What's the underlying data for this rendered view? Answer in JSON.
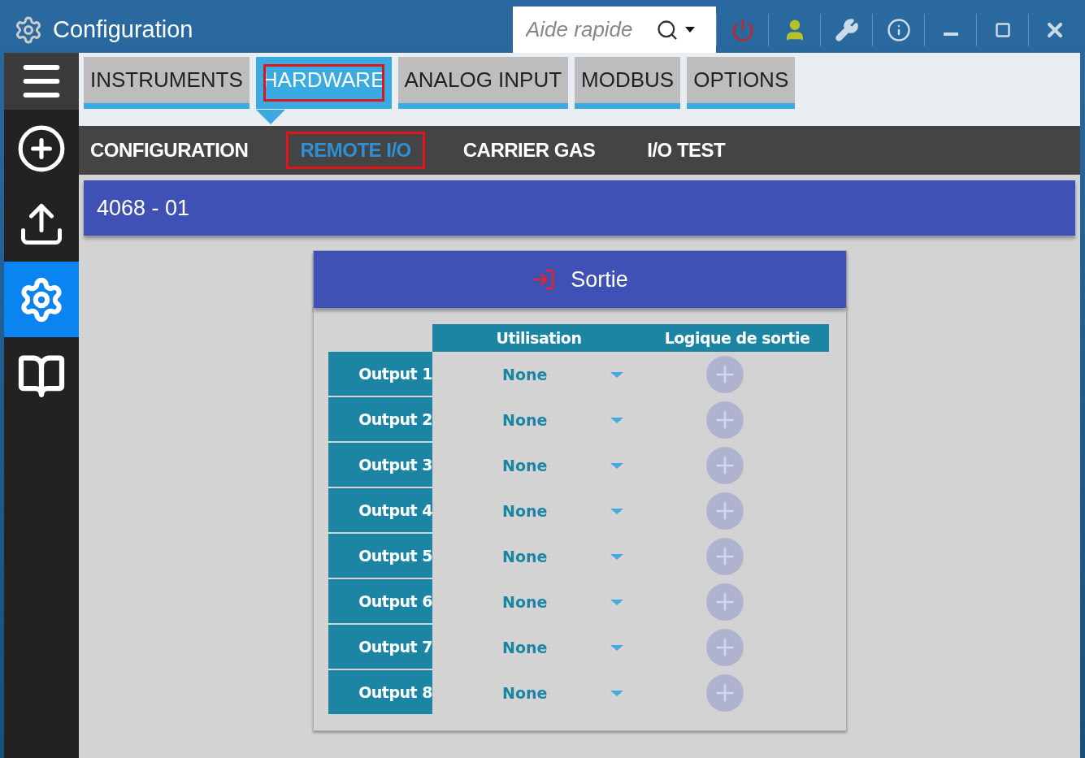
{
  "window": {
    "title": "Configuration"
  },
  "search": {
    "placeholder": "Aide rapide"
  },
  "sidebar": {
    "items": [
      {
        "kind": "menu",
        "selected": false
      },
      {
        "kind": "add",
        "selected": false
      },
      {
        "kind": "upload",
        "selected": false
      },
      {
        "kind": "tools",
        "selected": true
      },
      {
        "kind": "book",
        "selected": false
      }
    ]
  },
  "tabs": [
    {
      "label": "INSTRUMENTS",
      "selected": false,
      "highlighted": false
    },
    {
      "label": "HARDWARE",
      "selected": true,
      "highlighted": true
    },
    {
      "label": "ANALOG INPUT",
      "selected": false,
      "highlighted": false
    },
    {
      "label": "MODBUS",
      "selected": false,
      "highlighted": false
    },
    {
      "label": "OPTIONS",
      "selected": false,
      "highlighted": false
    }
  ],
  "subtabs": [
    {
      "label": "CONFIGURATION",
      "selected": false,
      "highlighted": false
    },
    {
      "label": "REMOTE I/O",
      "selected": true,
      "highlighted": true
    },
    {
      "label": "CARRIER GAS",
      "selected": false,
      "highlighted": false
    },
    {
      "label": "I/O TEST",
      "selected": false,
      "highlighted": false
    }
  ],
  "module": {
    "title": "4068 - 01"
  },
  "card": {
    "title": "Sortie",
    "columns": [
      "Utilisation",
      "Logique de sortie"
    ],
    "rows": [
      {
        "label": "Output 1",
        "value": "None"
      },
      {
        "label": "Output 2",
        "value": "None"
      },
      {
        "label": "Output 3",
        "value": "None"
      },
      {
        "label": "Output 4",
        "value": "None"
      },
      {
        "label": "Output 5",
        "value": "None"
      },
      {
        "label": "Output 6",
        "value": "None"
      },
      {
        "label": "Output 7",
        "value": "None"
      },
      {
        "label": "Output 8",
        "value": "None"
      }
    ]
  }
}
